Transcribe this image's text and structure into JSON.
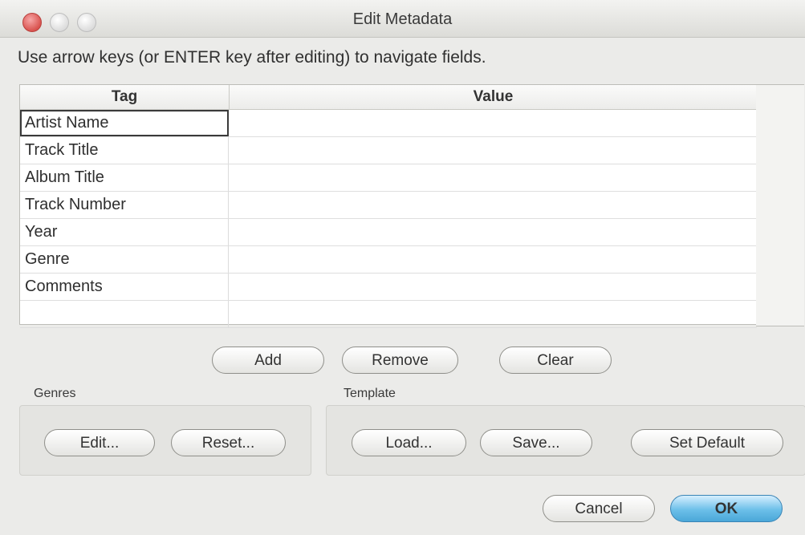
{
  "window": {
    "title": "Edit Metadata"
  },
  "hint": "Use arrow keys (or ENTER key after editing) to navigate fields.",
  "table": {
    "columns": [
      "Tag",
      "Value"
    ],
    "rows": [
      {
        "tag": "Artist Name",
        "value": ""
      },
      {
        "tag": "Track Title",
        "value": ""
      },
      {
        "tag": "Album Title",
        "value": ""
      },
      {
        "tag": "Track Number",
        "value": ""
      },
      {
        "tag": "Year",
        "value": ""
      },
      {
        "tag": "Genre",
        "value": ""
      },
      {
        "tag": "Comments",
        "value": ""
      },
      {
        "tag": "",
        "value": ""
      }
    ]
  },
  "table_buttons": {
    "add": "Add",
    "remove": "Remove",
    "clear": "Clear"
  },
  "genres": {
    "label": "Genres",
    "edit": "Edit...",
    "reset": "Reset..."
  },
  "template": {
    "label": "Template",
    "load": "Load...",
    "save": "Save...",
    "set_default": "Set Default"
  },
  "footer": {
    "cancel": "Cancel",
    "ok": "OK"
  },
  "colors": {
    "ok_accent": "#6cbfe9",
    "close_button": "#d9534f"
  }
}
